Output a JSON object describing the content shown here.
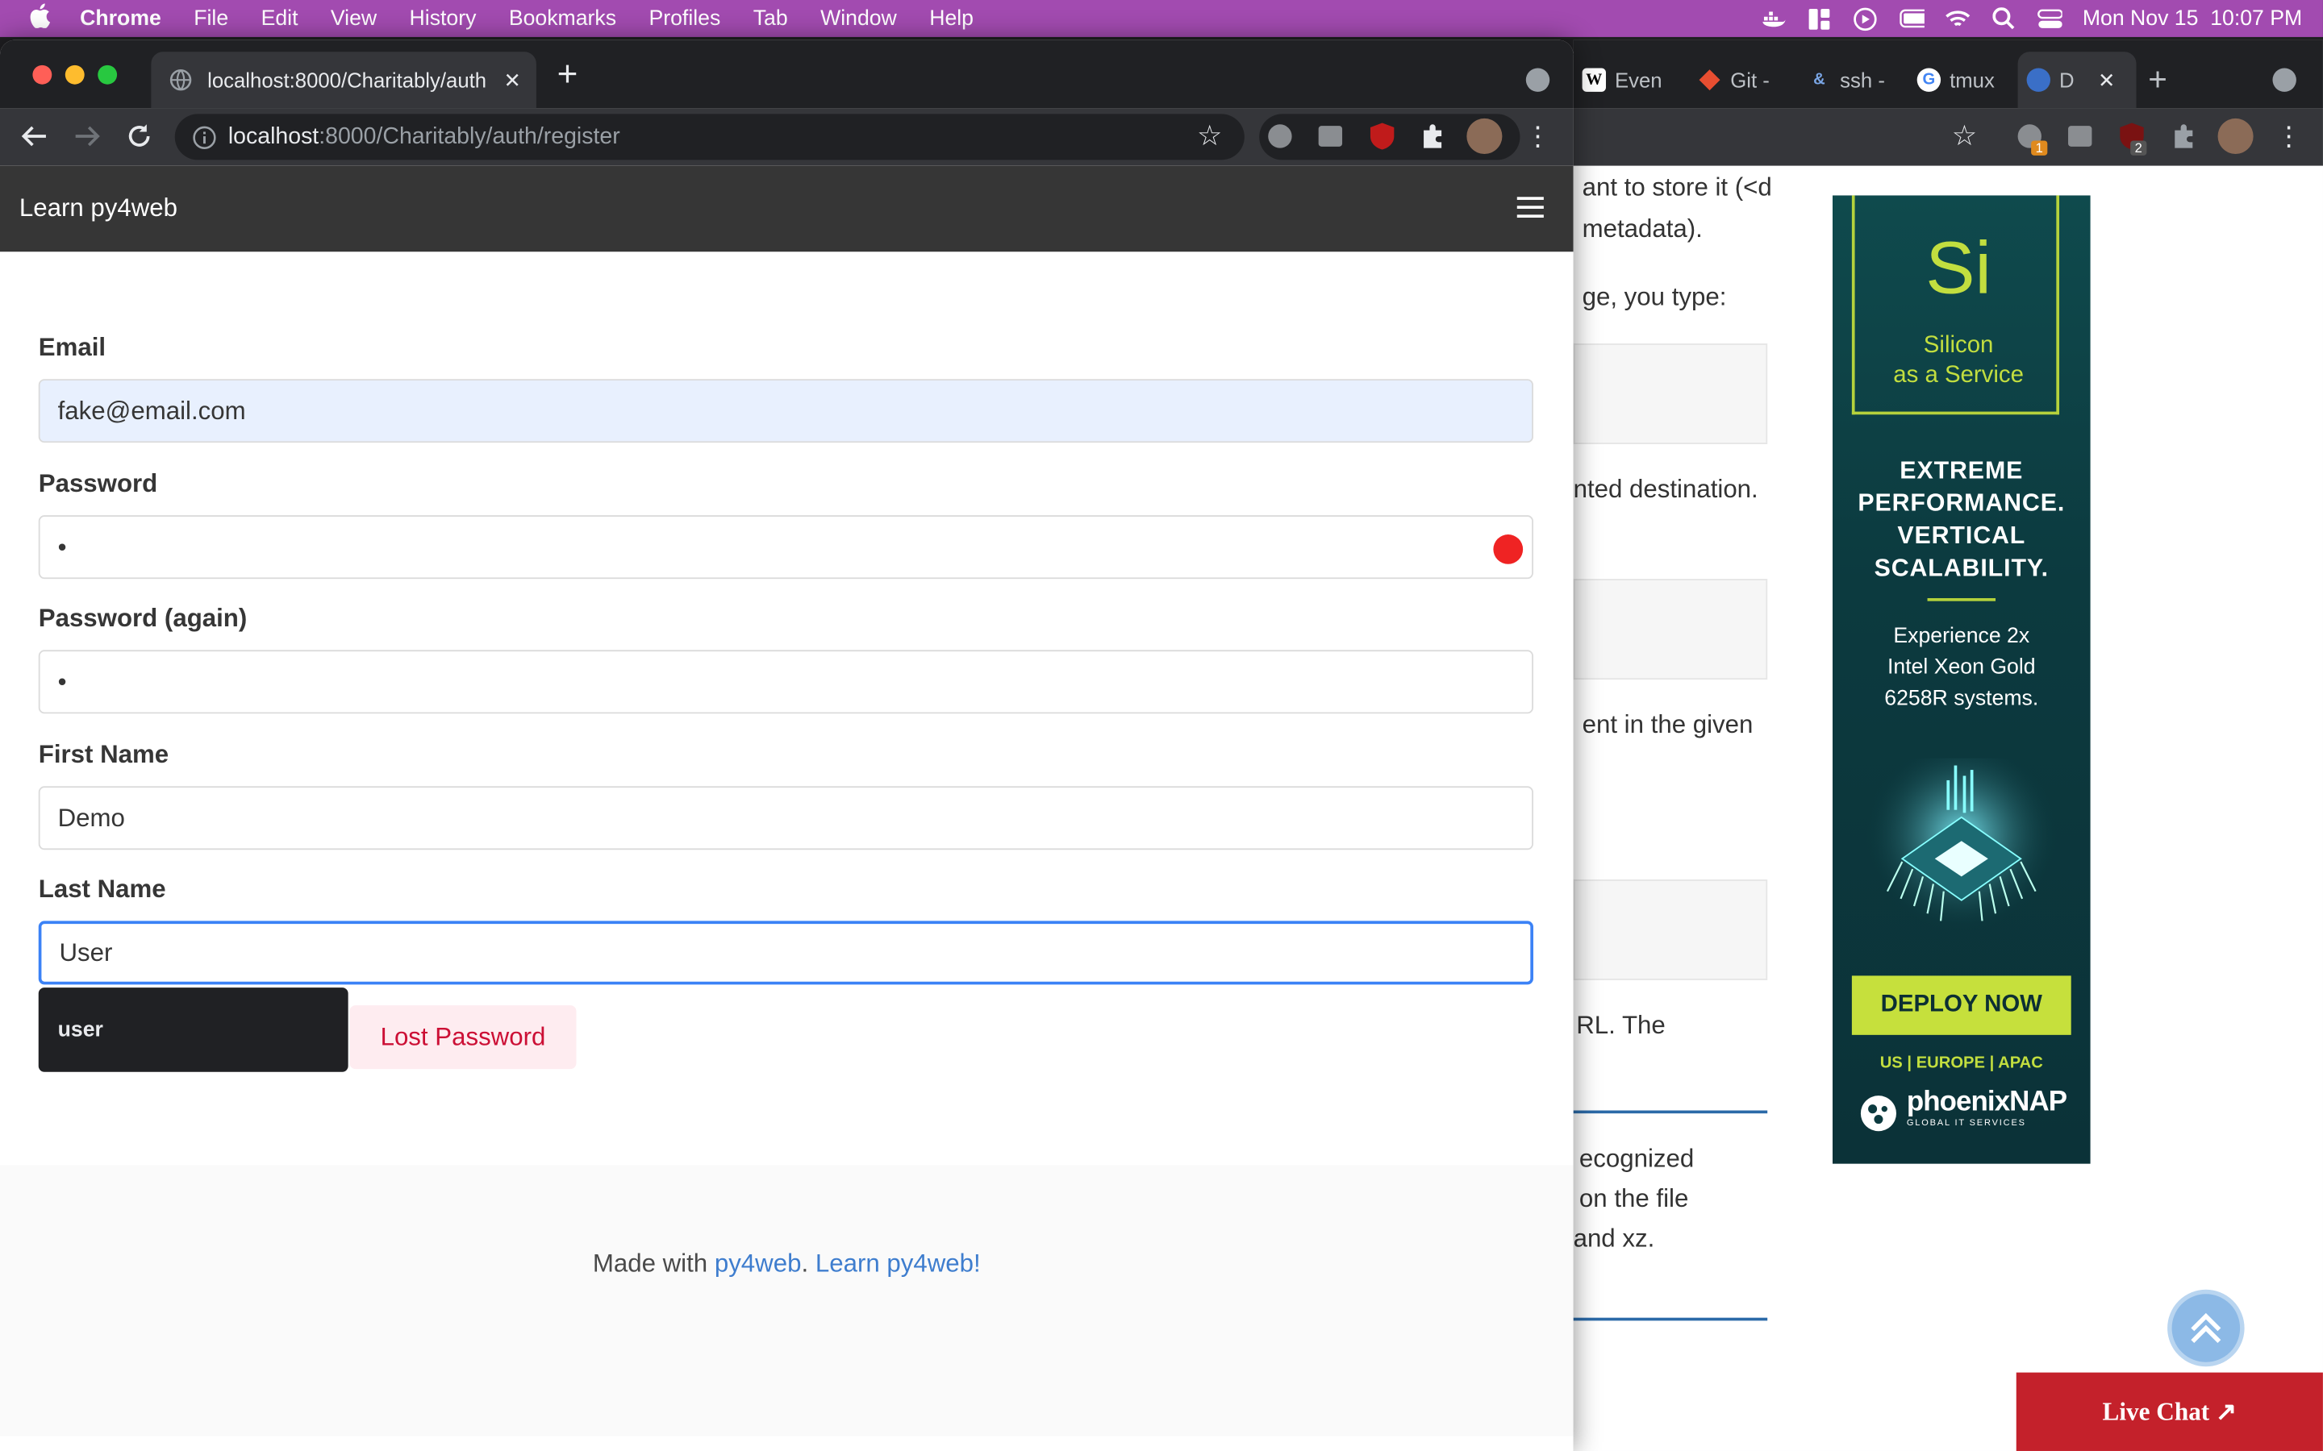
{
  "menubar": {
    "app": "Chrome",
    "items": [
      "File",
      "Edit",
      "View",
      "History",
      "Bookmarks",
      "Profiles",
      "Tab",
      "Window",
      "Help"
    ],
    "datetime": "Mon Nov 15  10:07 PM"
  },
  "main_window": {
    "tab_title": "localhost:8000/Charitably/auth",
    "url_host": "localhost",
    "url_rest": ":8000/Charitably/auth/register"
  },
  "bg_window": {
    "tabs": [
      {
        "icon": "W",
        "label": "Even"
      },
      {
        "icon": "git",
        "label": "Git -"
      },
      {
        "icon": "&",
        "label": "ssh -"
      },
      {
        "icon": "G",
        "label": "tmux"
      },
      {
        "icon": "globe",
        "label": "D"
      }
    ],
    "badges": {
      "ext1": "1",
      "ext2": "2"
    },
    "text_fragments": [
      "ant to store it (<d",
      "metadata).",
      "ge, you type:",
      "nted destination.",
      "ent in the given",
      "RL. The",
      "ecognized",
      "on the file",
      "and xz."
    ]
  },
  "ad": {
    "logo_big": "Si",
    "logo_sub1": "Silicon",
    "logo_sub2": "as a Service",
    "headline": [
      "EXTREME",
      "PERFORMANCE.",
      "VERTICAL",
      "SCALABILITY."
    ],
    "body": [
      "Experience 2x",
      "Intel Xeon Gold",
      "6258R systems."
    ],
    "cta": "DEPLOY NOW",
    "regions": "US | EUROPE | APAC",
    "brand": "phoenixNAP",
    "brand_sub": "GLOBAL IT SERVICES"
  },
  "live_chat": "Live Chat ↗",
  "page": {
    "brand": "Learn py4web",
    "fields": {
      "email": {
        "label": "Email",
        "value": "fake@email.com"
      },
      "password": {
        "label": "Password",
        "value": "•"
      },
      "password2": {
        "label": "Password (again)",
        "value": "•"
      },
      "first_name": {
        "label": "First Name",
        "value": "Demo"
      },
      "last_name": {
        "label": "Last Name",
        "value": "User"
      }
    },
    "autocomplete_option": "user",
    "lost_password": "Lost Password",
    "footer": {
      "prefix": "Made with ",
      "link1": "py4web",
      "sep": ". ",
      "link2": "Learn py4web!"
    }
  },
  "colors": {
    "menubar": "#a24bb0",
    "navbar": "#363636",
    "link": "#3e7dce",
    "danger": "#cc0f35",
    "ad_accent": "#c2de3f"
  }
}
